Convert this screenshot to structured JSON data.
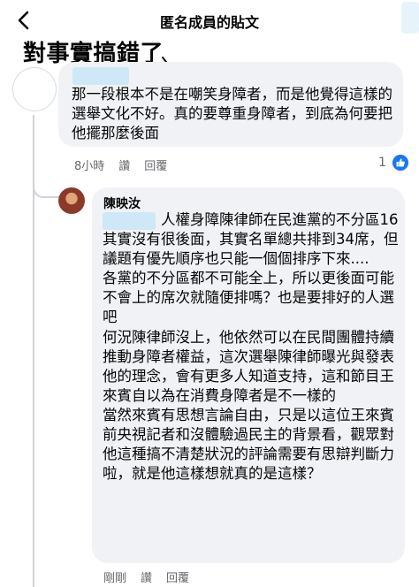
{
  "header": {
    "title": "匿名成員的貼文"
  },
  "annotation": {
    "text": "對事實搞錯了"
  },
  "comment1": {
    "text": "那一段根本不是在嘲笑身障者，而是他覺得這樣的選舉文化不好。真的要尊重身障者，到底為何要把他擺那麼後面",
    "time": "8小時",
    "like_label": "讚",
    "reply_label": "回覆",
    "reactions": "1",
    "reaction_icon": "thumbs-up-icon"
  },
  "comment2": {
    "author": "陳映汝",
    "text": "人權身障陳律師在民進黨的不分區16其實沒有很後面，其實名單總共排到34席，但議題有優先順序也只能一個個排序下來....\n各黨的不分區都不可能全上，所以更後面可能不會上的席次就隨便排嗎？也是要排好的人選吧\n何況陳律師沒上，他依然可以在民間團體持續推動身障者權益，這次選舉陳律師曝光與發表他的理念，會有更多人知道支持，這和節目王來賓自以為在消費身障者是不一樣的\n當然來賓有思想言論自由，只是以這位王來賓前央視記者和沒體驗過民主的背景看，觀眾對他這種搞不清楚狀況的評論需要有思辯判斷力啦，就是他這樣想就真的是這樣？",
    "time": "剛剛",
    "like_label": "讚",
    "reply_label": "回覆"
  },
  "colors": {
    "accent": "#1877f2",
    "bubble": "#f0f2f5",
    "meta": "#65676b"
  }
}
